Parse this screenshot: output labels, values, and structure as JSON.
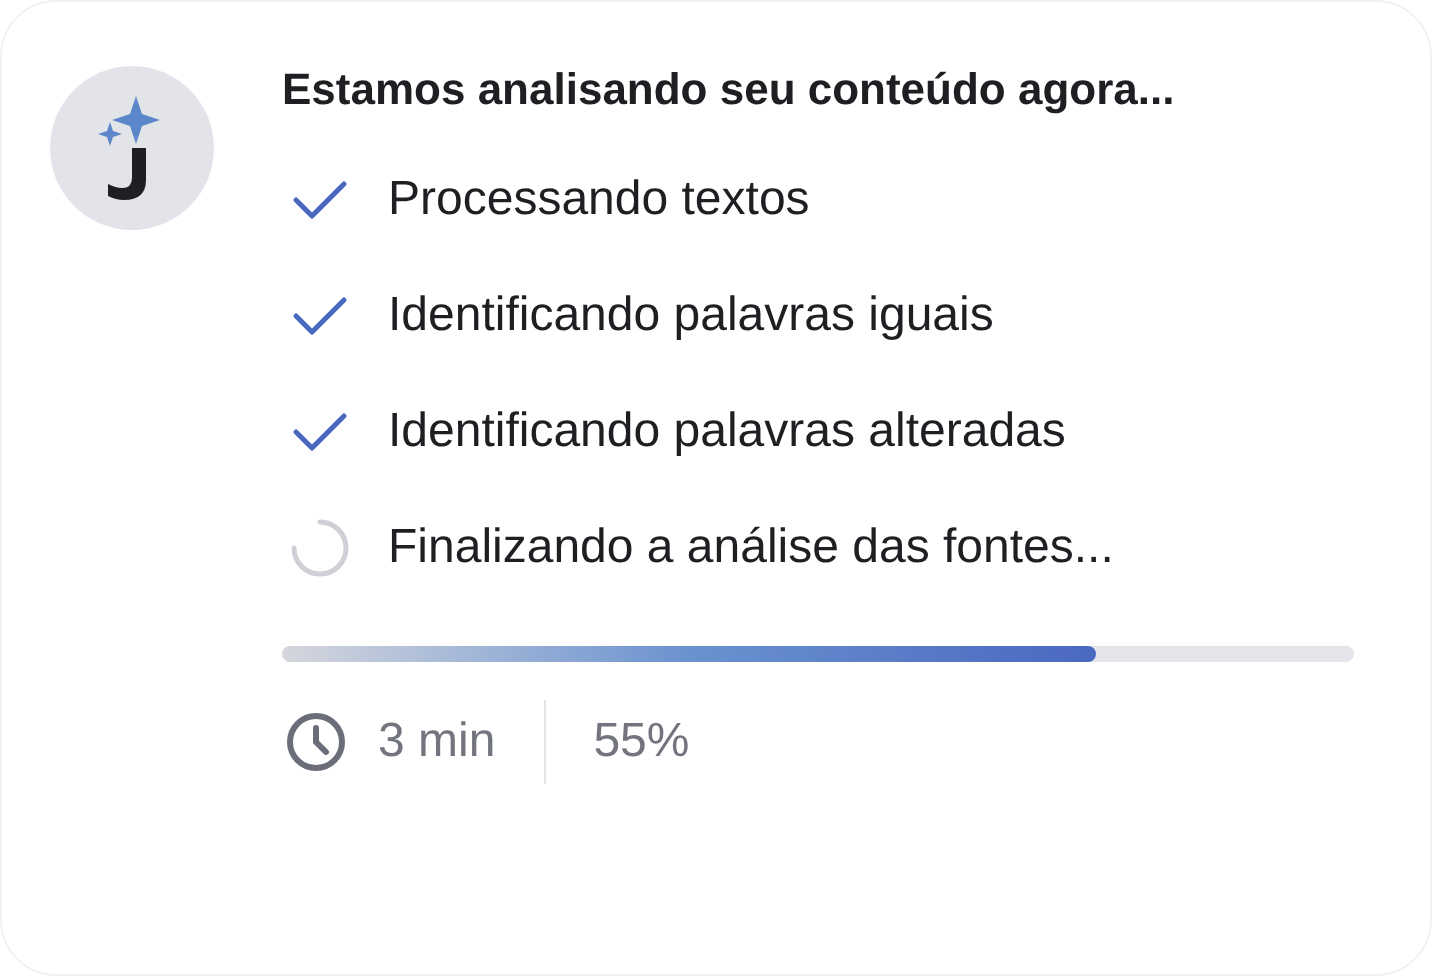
{
  "title": "Estamos analisando seu conteúdo agora...",
  "steps": [
    {
      "label": "Processando textos",
      "kind": "done"
    },
    {
      "label": "Identificando palavras iguais",
      "kind": "done"
    },
    {
      "label": "Identificando palavras alteradas",
      "kind": "done"
    },
    {
      "label": "Finalizando a análise das fontes...",
      "kind": "loading"
    }
  ],
  "progress": {
    "level": 0.76
  },
  "footer": {
    "time": "3 min",
    "percent": "55%"
  }
}
